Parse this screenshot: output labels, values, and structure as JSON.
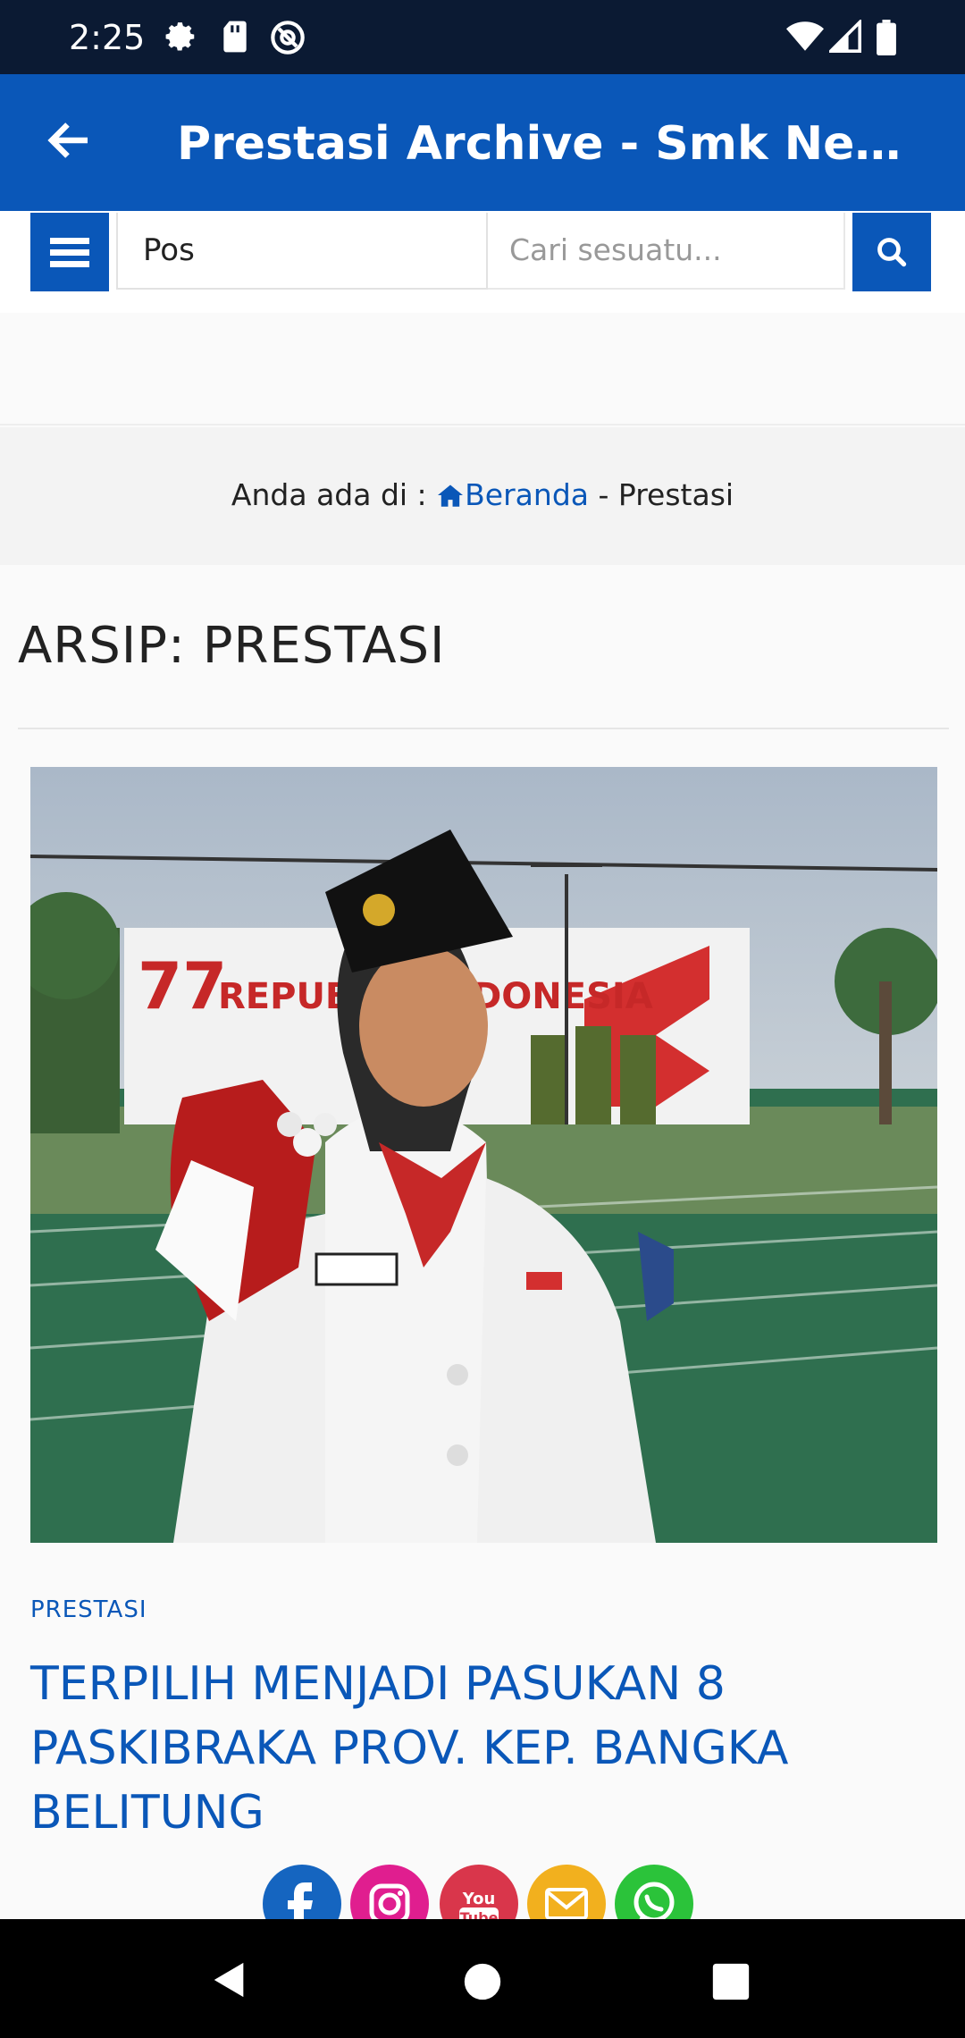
{
  "status_bar": {
    "time": "2:25",
    "icons": [
      "gear-icon",
      "sd-card-icon",
      "at-sign-icon",
      "wifi-icon",
      "signal-icon",
      "battery-icon"
    ]
  },
  "app_bar": {
    "title": "Prestasi Archive - Smk Negeri...",
    "back_icon": "arrow-left-icon",
    "color": "#0a57b8"
  },
  "search": {
    "menu_icon": "hamburger-icon",
    "type_value": "Pos",
    "placeholder": "Cari sesuatu...",
    "search_icon": "magnifier-icon"
  },
  "breadcrumb": {
    "prefix": "Anda ada di : ",
    "home_icon": "home-icon",
    "home_label": "Beranda",
    "separator": " - ",
    "current": "Prestasi"
  },
  "archive": {
    "heading": "ARSIP: PRESTASI"
  },
  "post": {
    "category": "PRESTASI",
    "title": "TERPILIH MENJADI PASUKAN 8 PASKIBRAKA PROV. KEP. BANGKA BELITUNG",
    "image_banner_text": "REPUBLIK INDONESIA"
  },
  "share": [
    {
      "name": "facebook-icon",
      "color": "#1565c0"
    },
    {
      "name": "instagram-icon",
      "color": "#e01e8f"
    },
    {
      "name": "youtube-icon",
      "color": "#d9364b"
    },
    {
      "name": "email-icon",
      "color": "#f2b01e"
    },
    {
      "name": "whatsapp-icon",
      "color": "#2bc33a"
    }
  ]
}
